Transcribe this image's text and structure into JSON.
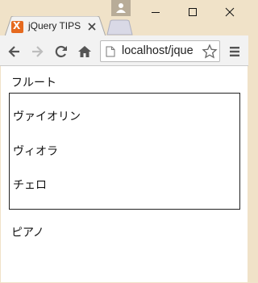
{
  "browser": {
    "tab_title": "jQuery TIPS",
    "url": "localhost/jque",
    "favicon_glyph": "X",
    "accent": "#e66a1f"
  },
  "content": {
    "first": "フルート",
    "grouped": [
      "ヴァイオリン",
      "ヴィオラ",
      "チェロ"
    ],
    "last": "ピアノ"
  }
}
